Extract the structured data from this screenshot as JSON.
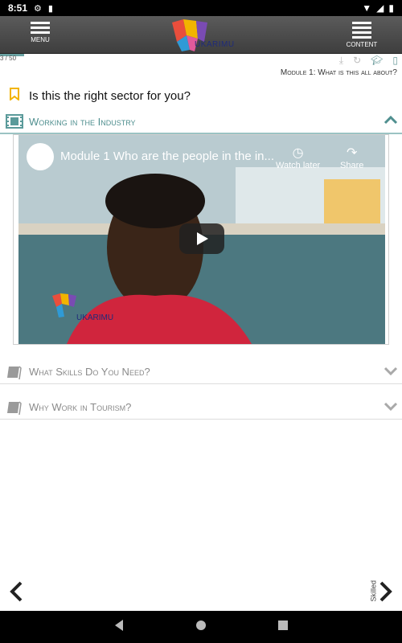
{
  "status_bar": {
    "time": "8:51"
  },
  "topbar": {
    "menu_label": "MENU",
    "content_label": "CONTENT",
    "logo_text": "UKARIMU"
  },
  "progress": {
    "text": "3 / 50",
    "fraction": 0.06
  },
  "module_title": "Module 1: What is this all about?",
  "question": "Is this the right sector for you?",
  "sections": {
    "working": "Working in the Industry",
    "skills": "What Skills Do You Need?",
    "tourism": "Why Work in Tourism?"
  },
  "video": {
    "title": "Module 1 Who are the people in the in...",
    "watch_later": "Watch later",
    "share": "Share",
    "watermark": "UKARIMU"
  },
  "bottom": {
    "level": "Skilled"
  },
  "colors": {
    "accent": "#4f8f8f",
    "bookmark": "#f2b400",
    "topbar": "#4a4a4a"
  }
}
